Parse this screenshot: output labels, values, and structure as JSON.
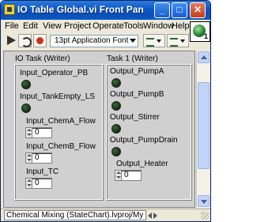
{
  "window": {
    "title": "IO Table Global.vi Front Panel on Che...",
    "minimize_label": "_",
    "maximize_label": "□",
    "close_label": "✕"
  },
  "menu": {
    "file": "File",
    "edit": "Edit",
    "view": "View",
    "project": "Project",
    "operate": "Operate",
    "tools": "Tools",
    "window": "Window",
    "help": "Help"
  },
  "toolbar": {
    "font_select": "13pt Application Font",
    "vi_icon_number": "1"
  },
  "io_task": {
    "title": "IO Task (Writer)",
    "indicators": [
      {
        "label": "Input_Operator_PB",
        "state": "off"
      },
      {
        "label": "Input_TankEmpty_LS",
        "state": "off"
      }
    ],
    "numerics": [
      {
        "label": "Input_ChemA_Flow",
        "value": "0"
      },
      {
        "label": "Input_ChemB_Flow",
        "value": "0"
      },
      {
        "label": "Input_TC",
        "value": "0"
      }
    ]
  },
  "task1": {
    "title": "Task 1 (Writer)",
    "indicators": [
      {
        "label": "Output_PumpA",
        "state": "off"
      },
      {
        "label": "Output_PumpB",
        "state": "off"
      },
      {
        "label": "Output_Stirrer",
        "state": "off"
      },
      {
        "label": "Output_PumpDrain",
        "state": "off"
      }
    ],
    "numerics": [
      {
        "label": "Output_Heater",
        "value": "0"
      }
    ]
  },
  "status": {
    "path": "Chemical Mixing (StateChart).lvproj/My Computer"
  },
  "colors": {
    "titlebar": "#0a56c9",
    "panel_bg": "#d0d0d0",
    "led_off": "#163616",
    "window_bg": "#ece9d8"
  }
}
